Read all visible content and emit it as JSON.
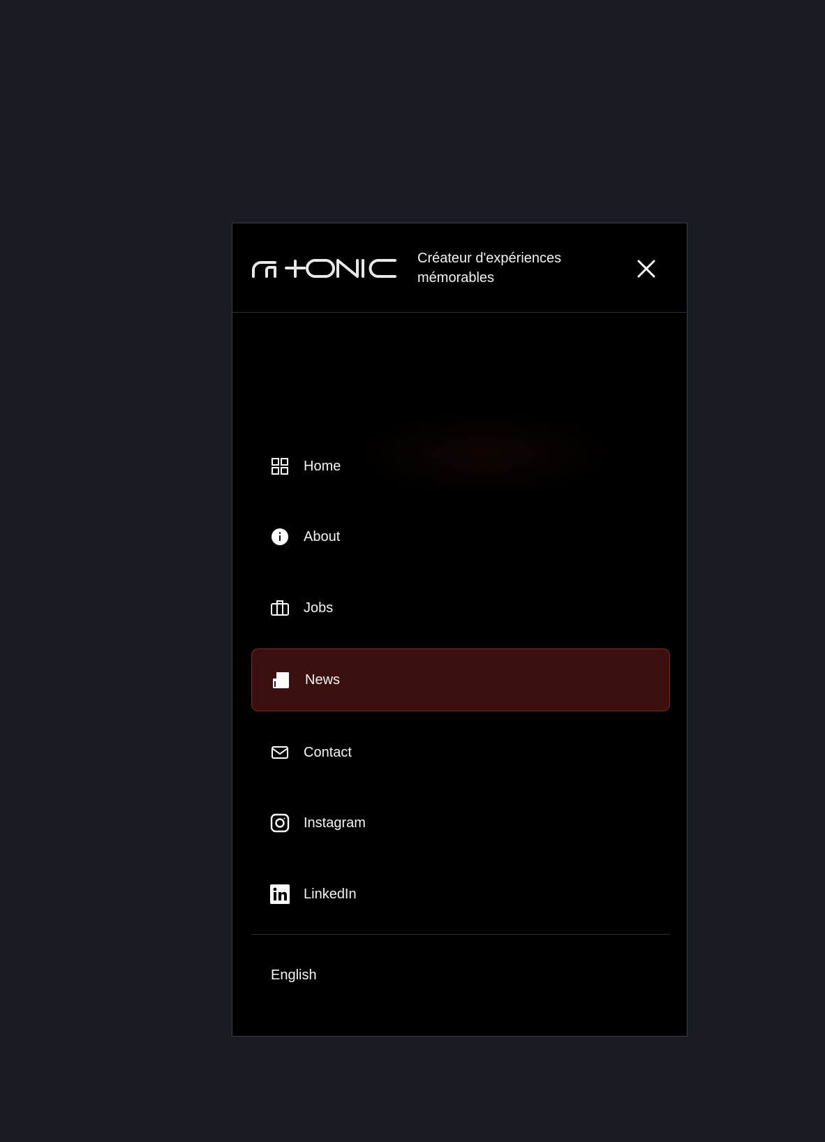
{
  "header": {
    "logo_text": "G+ONIC",
    "tagline_line1": "Créateur d'expériences",
    "tagline_line2": "mémorables",
    "close_icon": "close-icon"
  },
  "nav": {
    "items": [
      {
        "label": "Home",
        "icon": "grid-icon",
        "active": false
      },
      {
        "label": "About",
        "icon": "info-icon",
        "active": false
      },
      {
        "label": "Jobs",
        "icon": "briefcase-icon",
        "active": false
      },
      {
        "label": "News",
        "icon": "newspaper-icon",
        "active": true
      },
      {
        "label": "Contact",
        "icon": "mail-icon",
        "active": false
      },
      {
        "label": "Instagram",
        "icon": "instagram-icon",
        "active": false
      },
      {
        "label": "LinkedIn",
        "icon": "linkedin-icon",
        "active": false
      }
    ]
  },
  "language": {
    "label": "English"
  },
  "colors": {
    "page_background": "#1a1c24",
    "panel_background": "#000000",
    "active_background": "#3a1011",
    "active_border": "#8a2322",
    "text": "#f4f4f4"
  }
}
